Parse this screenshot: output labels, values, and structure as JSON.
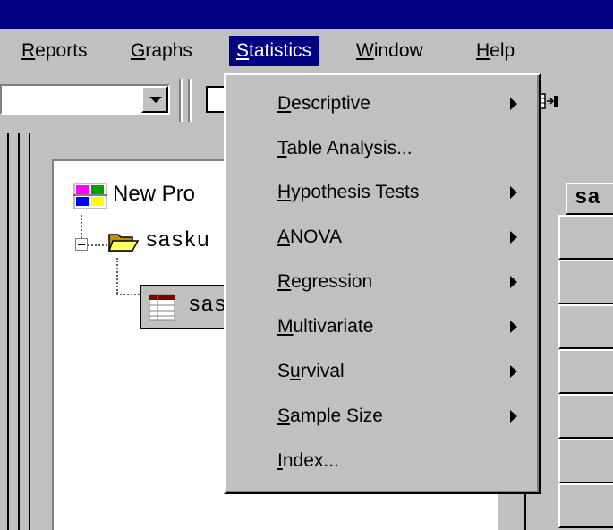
{
  "menubar": {
    "items": [
      {
        "pre": "",
        "u": "R",
        "post": "eports"
      },
      {
        "pre": "",
        "u": "G",
        "post": "raphs"
      },
      {
        "pre": "",
        "u": "S",
        "post": "tatistics"
      },
      {
        "pre": "",
        "u": "W",
        "post": "indow"
      },
      {
        "pre": "",
        "u": "H",
        "post": "elp"
      }
    ],
    "active_index": 2
  },
  "project_tree": {
    "root_label": "New Pro",
    "folder_label": "sasku",
    "dataset_label": "sas"
  },
  "table": {
    "header_label": "sa"
  },
  "statistics_menu": {
    "items": [
      {
        "pre": "",
        "u": "D",
        "post": "escriptive",
        "submenu": true
      },
      {
        "pre": "",
        "u": "T",
        "post": "able Analysis...",
        "submenu": false
      },
      {
        "pre": "",
        "u": "H",
        "post": "ypothesis Tests",
        "submenu": true
      },
      {
        "pre": "",
        "u": "A",
        "post": "NOVA",
        "submenu": true
      },
      {
        "pre": "",
        "u": "R",
        "post": "egression",
        "submenu": true
      },
      {
        "pre": "",
        "u": "M",
        "post": "ultivariate",
        "submenu": true
      },
      {
        "pre": "S",
        "u": "u",
        "post": "rvival",
        "submenu": true
      },
      {
        "pre": "",
        "u": "S",
        "post": "ample Size",
        "submenu": true
      },
      {
        "pre": "",
        "u": "I",
        "post": "ndex...",
        "submenu": false
      }
    ]
  },
  "colors": {
    "titlebar": "#000080",
    "face": "#c0c0c0",
    "highlight": "#000080"
  }
}
